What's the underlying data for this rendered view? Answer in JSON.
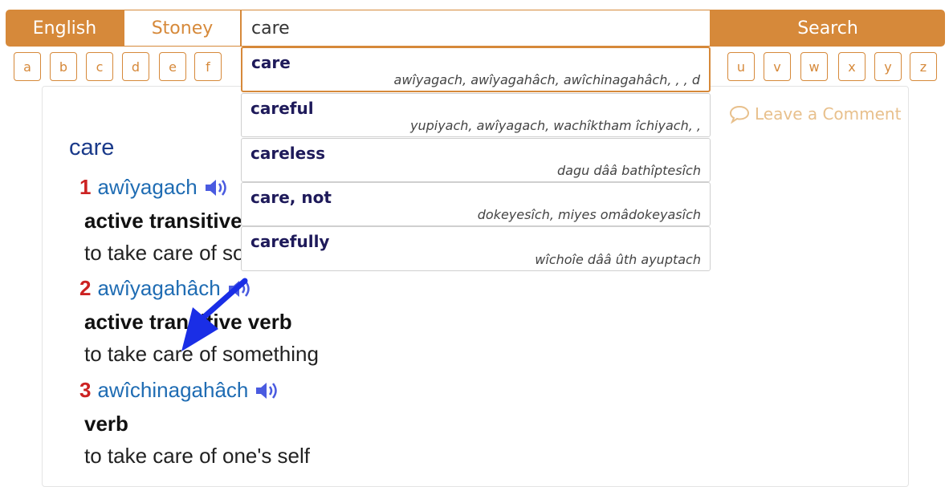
{
  "lang_toggle": {
    "english": "English",
    "stoney": "Stoney"
  },
  "search": {
    "value": "care",
    "button": "Search"
  },
  "letters": [
    "a",
    "b",
    "c",
    "d",
    "e",
    "f",
    "u",
    "v",
    "w",
    "x",
    "y",
    "z"
  ],
  "comment": {
    "label": "Leave a Comment"
  },
  "entry": {
    "title": "care",
    "senses": [
      {
        "num": "1",
        "word": "awîyagach",
        "pos": "active transitive",
        "def": "to take care of so"
      },
      {
        "num": "2",
        "word": "awîyagahâch",
        "pos": "active transitive verb",
        "def": "to take care of something"
      },
      {
        "num": "3",
        "word": "awîchinagahâch",
        "pos": "verb",
        "def": "to take care of one's self"
      }
    ]
  },
  "suggestions": [
    {
      "term": "care",
      "translation": "awîyagach, awîyagahâch, awîchinagahâch, , , d"
    },
    {
      "term": "careful",
      "translation": "yupiyach, awîyagach, wachîktham îchiyach, ,"
    },
    {
      "term": "careless",
      "translation": "dagu dââ bathîptesîch"
    },
    {
      "term": "care, not",
      "translation": "dokeyesîch, miyes omâdokeyasîch"
    },
    {
      "term": "carefully",
      "translation": "wîchoîe dââ ûth ayuptach"
    }
  ],
  "colors": {
    "accent": "#d6893a",
    "sense_num": "#cc2222",
    "sense_word": "#1f6cb3",
    "speaker": "#4a5be0",
    "arrow": "#1a2ee6"
  },
  "icons": [
    "speaker-icon",
    "comment-icon",
    "arrow-annotation"
  ]
}
